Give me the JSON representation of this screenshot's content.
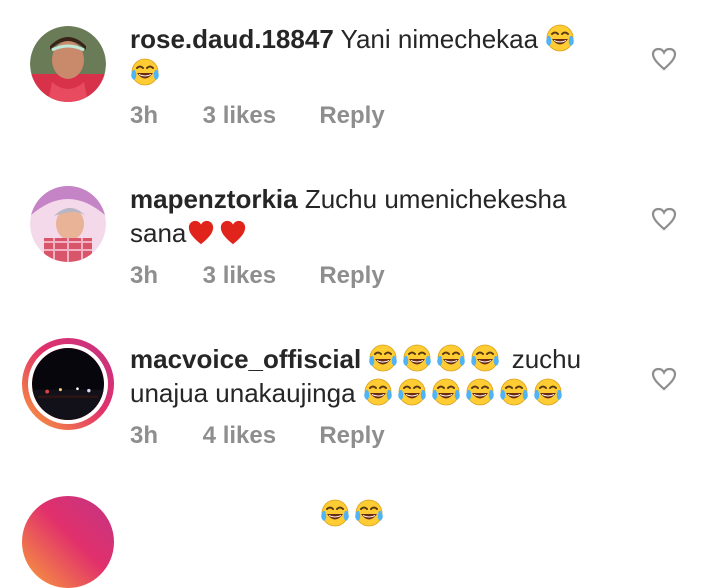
{
  "comments": [
    {
      "username": "rose.daud.18847",
      "text": "Yani nimechekaa",
      "time": "3h",
      "likes": "3 likes",
      "reply": "Reply",
      "avatar_color": "#e0435a"
    },
    {
      "username": "mapenztorkia",
      "text": "Zuchu umenichekesha sana",
      "time": "3h",
      "likes": "3 likes",
      "reply": "Reply",
      "avatar_color": "#c778c8"
    },
    {
      "username": "macvoice_offiscial",
      "text_a": "zuchu",
      "text_b": "unajua unakaujinga",
      "time": "3h",
      "likes": "4 likes",
      "reply": "Reply",
      "avatar_color": "#0b0b12",
      "story_ring": "#e1306c"
    }
  ],
  "icons": {
    "like": "heart-outline-icon",
    "laugh": "face-with-tears-of-joy-emoji",
    "heart": "red-heart-emoji"
  }
}
